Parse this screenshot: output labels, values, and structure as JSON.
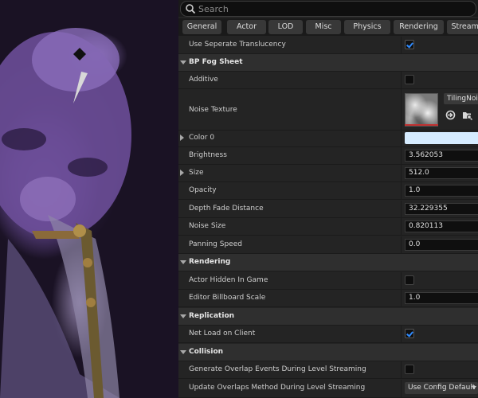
{
  "search": {
    "placeholder": "Search"
  },
  "tabs": [
    "General",
    "Actor",
    "LOD",
    "Misc",
    "Physics",
    "Rendering",
    "Streaming"
  ],
  "rows": [
    {
      "type": "prop",
      "label": "Use Seperate Translucency",
      "widget": "checkbox",
      "checked": true
    },
    {
      "type": "category",
      "label": "BP Fog Sheet"
    },
    {
      "type": "prop",
      "label": "Additive",
      "widget": "checkbox",
      "checked": false
    },
    {
      "type": "prop",
      "label": "Noise Texture",
      "widget": "texture",
      "value": "TilingNoise"
    },
    {
      "type": "prop",
      "label": "Color 0",
      "widget": "color",
      "expandable": true
    },
    {
      "type": "prop",
      "label": "Brightness",
      "widget": "number",
      "value": "3.562053"
    },
    {
      "type": "prop",
      "label": "Size",
      "widget": "number",
      "value": "512.0",
      "expandable": true
    },
    {
      "type": "prop",
      "label": "Opacity",
      "widget": "number",
      "value": "1.0"
    },
    {
      "type": "prop",
      "label": "Depth Fade Distance",
      "widget": "number",
      "value": "32.229355"
    },
    {
      "type": "prop",
      "label": "Noise Size",
      "widget": "number",
      "value": "0.820113"
    },
    {
      "type": "prop",
      "label": "Panning Speed",
      "widget": "number",
      "value": "0.0"
    },
    {
      "type": "category",
      "label": "Rendering"
    },
    {
      "type": "prop",
      "label": "Actor Hidden In Game",
      "widget": "checkbox",
      "checked": false
    },
    {
      "type": "prop",
      "label": "Editor Billboard Scale",
      "widget": "number",
      "value": "1.0"
    },
    {
      "type": "category",
      "label": "Replication"
    },
    {
      "type": "prop",
      "label": "Net Load on Client",
      "widget": "checkbox",
      "checked": true
    },
    {
      "type": "category",
      "label": "Collision"
    },
    {
      "type": "prop",
      "label": "Generate Overlap Events During Level Streaming",
      "widget": "checkbox",
      "checked": false
    },
    {
      "type": "prop",
      "label": "Update Overlaps Method During Level Streaming",
      "widget": "dropdown",
      "value": "Use Config Default"
    }
  ],
  "colors": {
    "color0": "#d6ecff",
    "checkmark": "#2f8bff",
    "panel": "#242424",
    "category": "#2f2f2f"
  },
  "icons": {
    "search": "search-icon",
    "browse": "browse-asset-icon",
    "use": "use-selected-icon"
  }
}
